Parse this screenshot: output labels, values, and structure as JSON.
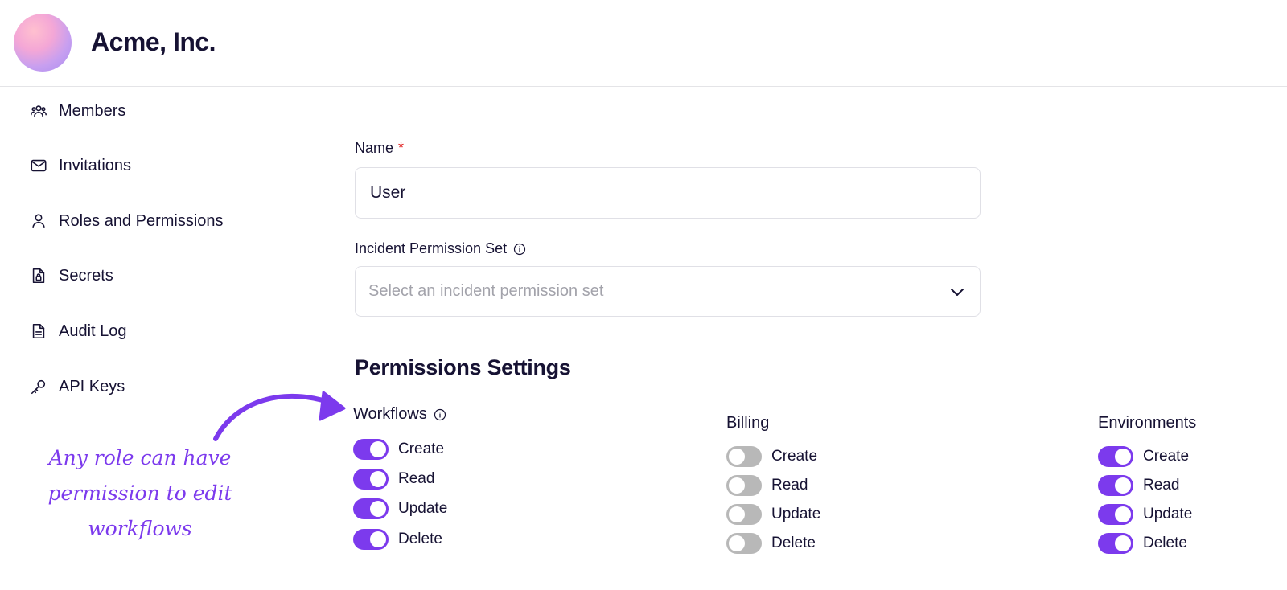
{
  "header": {
    "org_name": "Acme, Inc."
  },
  "sidebar": {
    "items": [
      {
        "label": "Members",
        "icon": "members-icon"
      },
      {
        "label": "Invitations",
        "icon": "envelope-icon"
      },
      {
        "label": "Roles and Permissions",
        "icon": "person-icon"
      },
      {
        "label": "Secrets",
        "icon": "lock-file-icon"
      },
      {
        "label": "Audit Log",
        "icon": "document-icon"
      },
      {
        "label": "API Keys",
        "icon": "key-icon"
      }
    ]
  },
  "form": {
    "name_label": "Name",
    "name_required_mark": "*",
    "name_value": "User",
    "incident_label": "Incident Permission Set",
    "incident_placeholder": "Select an incident permission set"
  },
  "permissions": {
    "title": "Permissions Settings",
    "groups": [
      {
        "title": "Workflows",
        "has_info": true,
        "toggles": [
          {
            "label": "Create",
            "on": true
          },
          {
            "label": "Read",
            "on": true
          },
          {
            "label": "Update",
            "on": true
          },
          {
            "label": "Delete",
            "on": true
          }
        ]
      },
      {
        "title": "Billing",
        "has_info": false,
        "toggles": [
          {
            "label": "Create",
            "on": false
          },
          {
            "label": "Read",
            "on": false
          },
          {
            "label": "Update",
            "on": false
          },
          {
            "label": "Delete",
            "on": false
          }
        ]
      },
      {
        "title": "Environments",
        "has_info": false,
        "toggles": [
          {
            "label": "Create",
            "on": true
          },
          {
            "label": "Read",
            "on": true
          },
          {
            "label": "Update",
            "on": true
          },
          {
            "label": "Delete",
            "on": true
          }
        ]
      }
    ]
  },
  "annotation": {
    "lines": [
      "Any role can have",
      "permission to edit",
      "workflows"
    ]
  },
  "colors": {
    "accent": "#7c3aed",
    "toggle_off": "#b8b8b8",
    "text": "#161233",
    "required": "#e02424"
  }
}
